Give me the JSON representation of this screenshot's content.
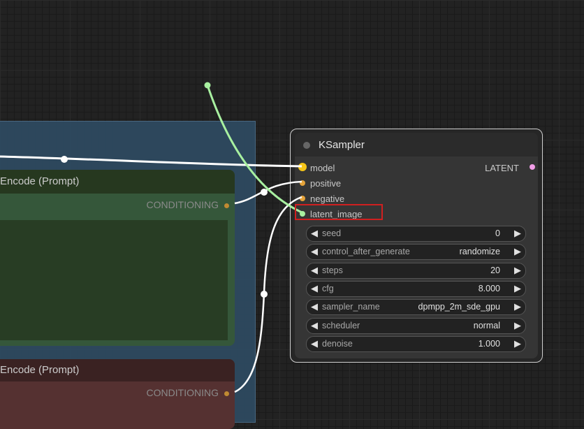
{
  "nodes": {
    "positive_encoder": {
      "title": "Encode (Prompt)",
      "output_label": "CONDITIONING"
    },
    "negative_encoder": {
      "title": "Encode (Prompt)",
      "output_label": "CONDITIONING"
    },
    "ksampler": {
      "title": "KSampler",
      "inputs": {
        "model": "model",
        "positive": "positive",
        "negative": "negative",
        "latent_image": "latent_image"
      },
      "output": "LATENT",
      "widgets": [
        {
          "label": "seed",
          "value": "0"
        },
        {
          "label": "control_after_generate",
          "value": "randomize"
        },
        {
          "label": "steps",
          "value": "20"
        },
        {
          "label": "cfg",
          "value": "8.000"
        },
        {
          "label": "sampler_name",
          "value": "dpmpp_2m_sde_gpu"
        },
        {
          "label": "scheduler",
          "value": "normal"
        },
        {
          "label": "denoise",
          "value": "1.000"
        }
      ]
    }
  },
  "colors": {
    "model": "#f5c518",
    "conditioning": "#e5a33a",
    "latent": "#a8f0a0",
    "latent_out": "#f29ee8",
    "highlight": "#d02020"
  }
}
